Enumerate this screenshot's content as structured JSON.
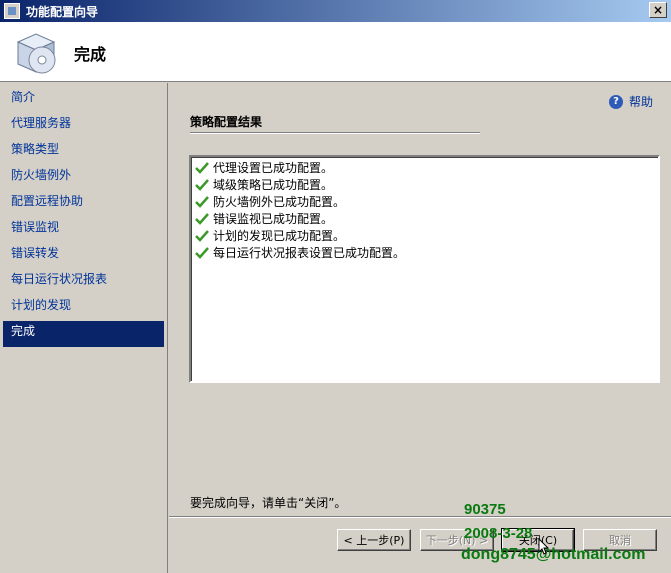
{
  "window": {
    "title": "功能配置向导",
    "close_glyph": "×"
  },
  "header": {
    "title": "完成",
    "icon": "install-disc-box-icon"
  },
  "sidebar": {
    "items": [
      {
        "label": "简介",
        "active": false
      },
      {
        "label": "代理服务器",
        "active": false
      },
      {
        "label": "策略类型",
        "active": false
      },
      {
        "label": "防火墙例外",
        "active": false
      },
      {
        "label": "配置远程协助",
        "active": false
      },
      {
        "label": "错误监视",
        "active": false
      },
      {
        "label": "错误转发",
        "active": false
      },
      {
        "label": "每日运行状况报表",
        "active": false
      },
      {
        "label": "计划的发现",
        "active": false
      },
      {
        "label": "完成",
        "active": true
      }
    ]
  },
  "content": {
    "help_label": "帮助",
    "section_title": "策略配置结果",
    "results": [
      "代理设置已成功配置。",
      "域级策略已成功配置。",
      "防火墙例外已成功配置。",
      "错误监视已成功配置。",
      "计划的发现已成功配置。",
      "每日运行状况报表设置已成功配置。"
    ],
    "footer_text": "要完成向导，请单击“关闭”。"
  },
  "buttons": {
    "back": "< 上一步(P)",
    "next": "下一步(N) >",
    "close": "关闭(C)",
    "cancel": "取消"
  },
  "watermark": {
    "line1": "90375",
    "line2": "2008-3-28",
    "line3": "dong8745@hotmail.com"
  },
  "colors": {
    "accent": "#0a246a",
    "link": "#003399",
    "check": "#3c9a28",
    "watermark": "#0a7a10"
  }
}
